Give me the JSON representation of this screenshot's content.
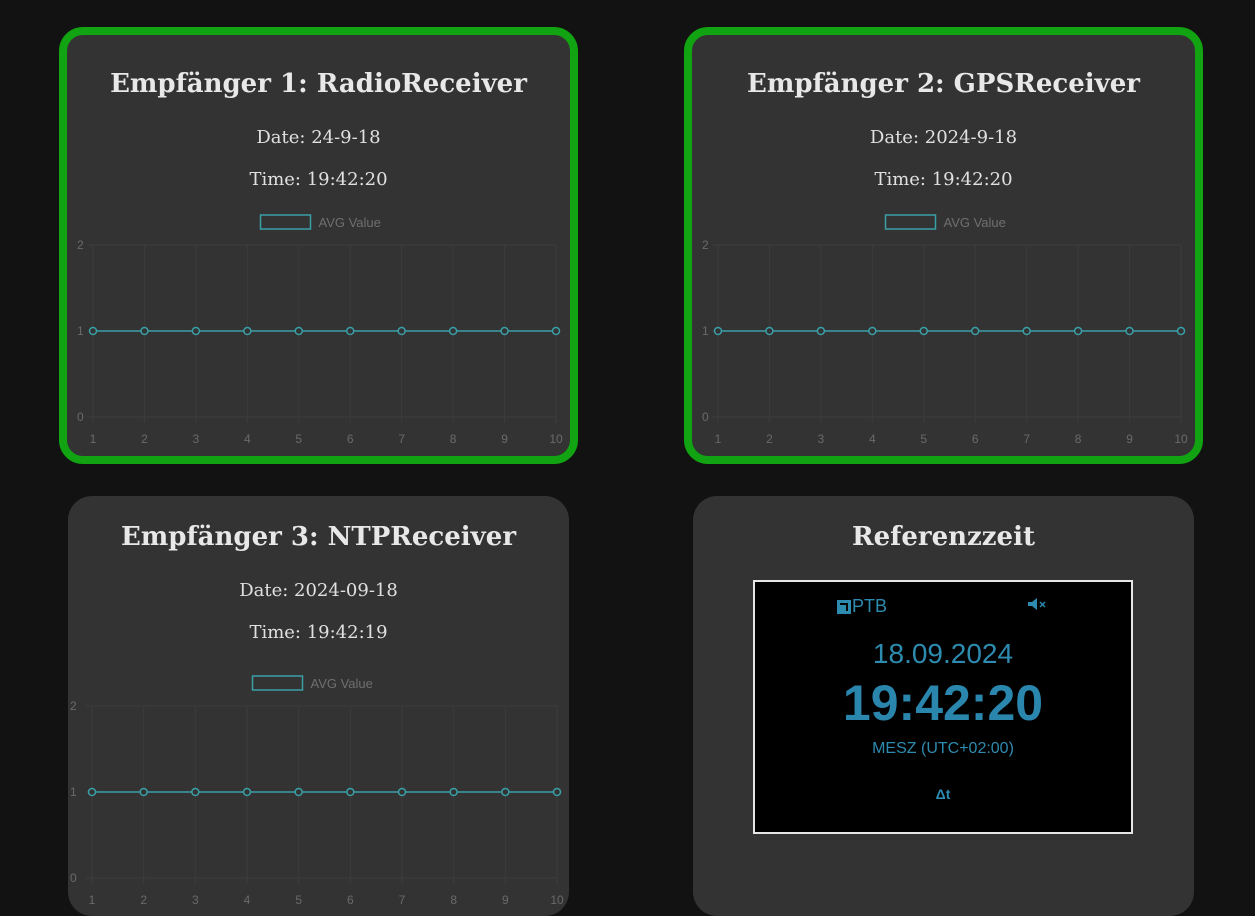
{
  "colors": {
    "background": "#121212",
    "card": "#333333",
    "active_border": "#11a311",
    "series": "#3aa0a8",
    "clock_text": "#2e8bb0"
  },
  "cards": [
    {
      "title": "Empfänger 1: RadioReceiver",
      "date": "Date: 24-9-18",
      "time": "Time: 19:42:20",
      "active": true,
      "chart_data": {
        "type": "line",
        "legend": "AVG Value",
        "x": [
          1,
          2,
          3,
          4,
          5,
          6,
          7,
          8,
          9,
          10
        ],
        "series": [
          {
            "name": "AVG Value",
            "values": [
              1,
              1,
              1,
              1,
              1,
              1,
              1,
              1,
              1,
              1
            ]
          }
        ],
        "ylim": [
          0,
          2
        ],
        "yticks": [
          0,
          1,
          2
        ],
        "grid": true
      }
    },
    {
      "title": "Empfänger 2: GPSReceiver",
      "date": "Date: 2024-9-18",
      "time": "Time: 19:42:20",
      "active": true,
      "chart_data": {
        "type": "line",
        "legend": "AVG Value",
        "x": [
          1,
          2,
          3,
          4,
          5,
          6,
          7,
          8,
          9,
          10
        ],
        "series": [
          {
            "name": "AVG Value",
            "values": [
              1,
              1,
              1,
              1,
              1,
              1,
              1,
              1,
              1,
              1
            ]
          }
        ],
        "ylim": [
          0,
          2
        ],
        "yticks": [
          0,
          1,
          2
        ],
        "grid": true
      }
    },
    {
      "title": "Empfänger 3: NTPReceiver",
      "date": "Date: 2024-09-18",
      "time": "Time: 19:42:19",
      "active": false,
      "chart_data": {
        "type": "line",
        "legend": "AVG Value",
        "x": [
          1,
          2,
          3,
          4,
          5,
          6,
          7,
          8,
          9,
          10
        ],
        "series": [
          {
            "name": "AVG Value",
            "values": [
              1,
              1,
              1,
              1,
              1,
              1,
              1,
              1,
              1,
              1
            ]
          }
        ],
        "ylim": [
          0,
          2
        ],
        "yticks": [
          0,
          1,
          2
        ],
        "grid": true
      }
    }
  ],
  "reference": {
    "title": "Referenzzeit",
    "logo_text": "PTB",
    "mute_icon": "speaker-mute-icon",
    "date": "18.09.2024",
    "time": "19:42:20",
    "zone": "MESZ (UTC+02:00)",
    "delta": "Δt"
  }
}
